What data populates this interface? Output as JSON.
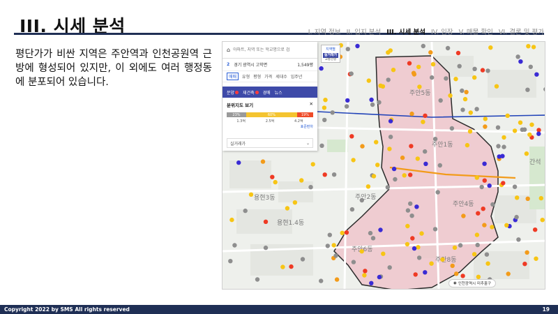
{
  "slide": {
    "title": "III. 시세 분석",
    "nav": [
      "I. 지역 정보",
      "II. 입지 분석",
      "III. 시세 분석",
      "IV. 임장",
      "V. 매물 확인",
      "VI. 결론 및 평가"
    ],
    "active_nav_index": 2,
    "body_text": "평단가가 비싼 지역은 주안역과 인천공원역 근방에 형성되어 있지만, 이 외에도 여러 행정동에 분포되어 있습니다.",
    "footer_left": "Copyright 2022 by SMS All rights reserved",
    "page_number": "19"
  },
  "map": {
    "search_placeholder": "아파트, 지역 또는 학교명으로 검",
    "address_index": "2",
    "address": "경기 광역시 고학면",
    "address_count": "1,549평",
    "filters": [
      "매매",
      "유형",
      "평형",
      "가격",
      "세대수",
      "입주년"
    ],
    "tabs": [
      "분양",
      "재건축",
      "경매",
      "뉴스"
    ],
    "distribution_title": "분위지도 보기",
    "distribution_segments": [
      {
        "label": "23%",
        "value": 23,
        "color": "#9a9a9a"
      },
      {
        "label": "60%",
        "value": 60,
        "color": "#f4c430"
      },
      {
        "label": "19%",
        "value": 19,
        "color": "#ef4b28"
      }
    ],
    "distribution_values": [
      "1.3억",
      "2.5억",
      "4.2억"
    ],
    "distribution_note": "표준편차",
    "dropdown_label": "실거래가",
    "realprice_label_top": "지역별",
    "realprice_label": "실거래가",
    "realprice_sub": "교통현황",
    "district_chip": "인천광역시 미추홀구",
    "colors": {
      "gray": "#8e8e8e",
      "yellow": "#f7c515",
      "orange": "#f39b1a",
      "red": "#ef3a24",
      "blue": "#3a2bd4",
      "area_fill": "#efc6cc",
      "boundary": "#2a2a2a",
      "rail": "#2143b8"
    },
    "dong_labels": [
      "주안5동",
      "주안1동",
      "주안2동",
      "주안4동",
      "주안8동",
      "주안6동",
      "용현3동",
      "용현1.4동",
      "간석"
    ]
  }
}
